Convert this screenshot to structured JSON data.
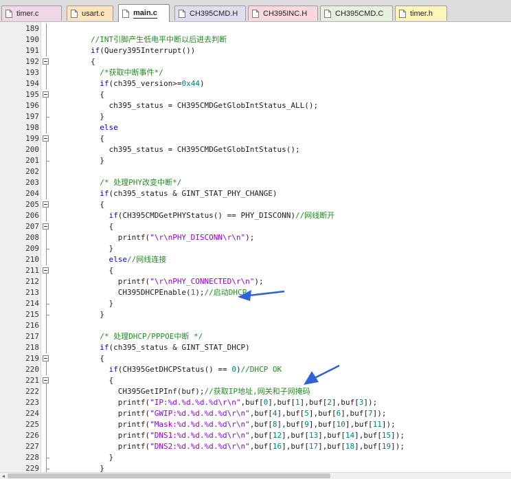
{
  "tabs": [
    {
      "label": "timer.c",
      "color": "#f0d8e6",
      "active": false
    },
    {
      "label": "usart.c",
      "color": "#fbe4bd",
      "active": false
    },
    {
      "label": "main.c",
      "color": "#ffffff",
      "active": true
    },
    {
      "label": "CH395CMD.H",
      "color": "#e2dcf0",
      "active": false
    },
    {
      "label": "CH395INC.H",
      "color": "#f8d8dc",
      "active": false
    },
    {
      "label": "CH395CMD.C",
      "color": "#e6f0dc",
      "active": false
    },
    {
      "label": "timer.h",
      "color": "#fff4bc",
      "active": false
    }
  ],
  "code": {
    "lines": [
      {
        "n": "189",
        "fold": "line",
        "tokens": []
      },
      {
        "n": "190",
        "fold": "line",
        "tokens": [
          [
            "        ",
            ""
          ],
          [
            "//INT引脚产生低电平中断以后进去判断",
            "cm"
          ]
        ]
      },
      {
        "n": "191",
        "fold": "line",
        "tokens": [
          [
            "        ",
            ""
          ],
          [
            "if",
            "kw"
          ],
          [
            "(Query395Interrupt())",
            ""
          ]
        ]
      },
      {
        "n": "192",
        "fold": "box",
        "tokens": [
          [
            "        {",
            ""
          ]
        ]
      },
      {
        "n": "193",
        "fold": "line",
        "tokens": [
          [
            "          ",
            ""
          ],
          [
            "/*获取中断事件*/",
            "cm"
          ]
        ]
      },
      {
        "n": "194",
        "fold": "line",
        "tokens": [
          [
            "          ",
            ""
          ],
          [
            "if",
            "kw"
          ],
          [
            "(ch395_version>=",
            ""
          ],
          [
            "0x44",
            "nm"
          ],
          [
            ")",
            ""
          ]
        ]
      },
      {
        "n": "195",
        "fold": "box",
        "tokens": [
          [
            "          {",
            ""
          ]
        ]
      },
      {
        "n": "196",
        "fold": "line",
        "tokens": [
          [
            "            ch395_status = CH395CMDGetGlobIntStatus_ALL();",
            ""
          ]
        ]
      },
      {
        "n": "197",
        "fold": "end",
        "tokens": [
          [
            "          }",
            ""
          ]
        ]
      },
      {
        "n": "198",
        "fold": "line",
        "tokens": [
          [
            "          ",
            ""
          ],
          [
            "else",
            "kw"
          ]
        ]
      },
      {
        "n": "199",
        "fold": "box",
        "tokens": [
          [
            "          {",
            ""
          ]
        ]
      },
      {
        "n": "200",
        "fold": "line",
        "tokens": [
          [
            "            ch395_status = CH395CMDGetGlobIntStatus();",
            ""
          ]
        ]
      },
      {
        "n": "201",
        "fold": "end",
        "tokens": [
          [
            "          }",
            ""
          ]
        ]
      },
      {
        "n": "202",
        "fold": "line",
        "tokens": []
      },
      {
        "n": "203",
        "fold": "line",
        "tokens": [
          [
            "          ",
            ""
          ],
          [
            "/* 处理PHY改变中断*/",
            "cm"
          ]
        ]
      },
      {
        "n": "204",
        "fold": "line",
        "tokens": [
          [
            "          ",
            ""
          ],
          [
            "if",
            "kw"
          ],
          [
            "(ch395_status & GINT_STAT_PHY_CHANGE)",
            ""
          ]
        ]
      },
      {
        "n": "205",
        "fold": "box",
        "tokens": [
          [
            "          {",
            ""
          ]
        ]
      },
      {
        "n": "206",
        "fold": "line",
        "tokens": [
          [
            "            ",
            ""
          ],
          [
            "if",
            "kw"
          ],
          [
            "(CH395CMDGetPHYStatus() == PHY_DISCONN)",
            ""
          ],
          [
            "//网线断开",
            "cm"
          ]
        ]
      },
      {
        "n": "207",
        "fold": "box",
        "tokens": [
          [
            "            {",
            ""
          ]
        ]
      },
      {
        "n": "208",
        "fold": "line",
        "tokens": [
          [
            "              printf(",
            ""
          ],
          [
            "\"\\r\\nPHY_DISCONN\\r\\n\"",
            "st"
          ],
          [
            ");",
            ""
          ]
        ]
      },
      {
        "n": "209",
        "fold": "end",
        "tokens": [
          [
            "            }",
            ""
          ]
        ]
      },
      {
        "n": "210",
        "fold": "line",
        "tokens": [
          [
            "            ",
            ""
          ],
          [
            "else",
            "kw"
          ],
          [
            "//网线连接",
            "cm"
          ]
        ]
      },
      {
        "n": "211",
        "fold": "box",
        "tokens": [
          [
            "            {",
            ""
          ]
        ]
      },
      {
        "n": "212",
        "fold": "line",
        "tokens": [
          [
            "              printf(",
            ""
          ],
          [
            "\"\\r\\nPHY_CONNECTED\\r\\n\"",
            "st"
          ],
          [
            ");",
            ""
          ]
        ]
      },
      {
        "n": "213",
        "fold": "line",
        "tokens": [
          [
            "              CH395DHCPEnable(",
            ""
          ],
          [
            "1",
            "nm"
          ],
          [
            ");",
            ""
          ],
          [
            "//启动DHCP",
            "cm"
          ]
        ]
      },
      {
        "n": "214",
        "fold": "end",
        "tokens": [
          [
            "            }",
            ""
          ]
        ]
      },
      {
        "n": "215",
        "fold": "end",
        "tokens": [
          [
            "          }",
            ""
          ]
        ]
      },
      {
        "n": "216",
        "fold": "line",
        "tokens": []
      },
      {
        "n": "217",
        "fold": "line",
        "tokens": [
          [
            "          ",
            ""
          ],
          [
            "/* 处理DHCP/PPPOE中断 */",
            "cm"
          ]
        ]
      },
      {
        "n": "218",
        "fold": "line",
        "tokens": [
          [
            "          ",
            ""
          ],
          [
            "if",
            "kw"
          ],
          [
            "(ch395_status & GINT_STAT_DHCP)",
            ""
          ]
        ]
      },
      {
        "n": "219",
        "fold": "box",
        "tokens": [
          [
            "          {",
            ""
          ]
        ]
      },
      {
        "n": "220",
        "fold": "line",
        "tokens": [
          [
            "            ",
            ""
          ],
          [
            "if",
            "kw"
          ],
          [
            "(CH395GetDHCPStatus() == ",
            ""
          ],
          [
            "0",
            "nm"
          ],
          [
            ")",
            ""
          ],
          [
            "//DHCP OK",
            "cm"
          ]
        ]
      },
      {
        "n": "221",
        "fold": "box",
        "tokens": [
          [
            "            {",
            ""
          ]
        ]
      },
      {
        "n": "222",
        "fold": "line",
        "tokens": [
          [
            "              CH395GetIPInf(buf);",
            ""
          ],
          [
            "//获取IP地址,网关和子网掩码",
            "cm"
          ]
        ]
      },
      {
        "n": "223",
        "fold": "line",
        "tokens": [
          [
            "              printf(",
            ""
          ],
          [
            "\"IP:%d.%d.%d.%d\\r\\n\"",
            "st"
          ],
          [
            ",buf[",
            ""
          ],
          [
            "0",
            "nm"
          ],
          [
            "],buf[",
            ""
          ],
          [
            "1",
            "nm"
          ],
          [
            "],buf[",
            ""
          ],
          [
            "2",
            "nm"
          ],
          [
            "],buf[",
            ""
          ],
          [
            "3",
            "nm"
          ],
          [
            "]);",
            ""
          ]
        ]
      },
      {
        "n": "224",
        "fold": "line",
        "tokens": [
          [
            "              printf(",
            ""
          ],
          [
            "\"GWIP:%d.%d.%d.%d\\r\\n\"",
            "st"
          ],
          [
            ",buf[",
            ""
          ],
          [
            "4",
            "nm"
          ],
          [
            "],buf[",
            ""
          ],
          [
            "5",
            "nm"
          ],
          [
            "],buf[",
            ""
          ],
          [
            "6",
            "nm"
          ],
          [
            "],buf[",
            ""
          ],
          [
            "7",
            "nm"
          ],
          [
            "]);",
            ""
          ]
        ]
      },
      {
        "n": "225",
        "fold": "line",
        "tokens": [
          [
            "              printf(",
            ""
          ],
          [
            "\"Mask:%d.%d.%d.%d\\r\\n\"",
            "st"
          ],
          [
            ",buf[",
            ""
          ],
          [
            "8",
            "nm"
          ],
          [
            "],buf[",
            ""
          ],
          [
            "9",
            "nm"
          ],
          [
            "],buf[",
            ""
          ],
          [
            "10",
            "nm"
          ],
          [
            "],buf[",
            ""
          ],
          [
            "11",
            "nm"
          ],
          [
            "]);",
            ""
          ]
        ]
      },
      {
        "n": "226",
        "fold": "line",
        "tokens": [
          [
            "              printf(",
            ""
          ],
          [
            "\"DNS1:%d.%d.%d.%d\\r\\n\"",
            "st"
          ],
          [
            ",buf[",
            ""
          ],
          [
            "12",
            "nm"
          ],
          [
            "],buf[",
            ""
          ],
          [
            "13",
            "nm"
          ],
          [
            "],buf[",
            ""
          ],
          [
            "14",
            "nm"
          ],
          [
            "],buf[",
            ""
          ],
          [
            "15",
            "nm"
          ],
          [
            "]);",
            ""
          ]
        ]
      },
      {
        "n": "227",
        "fold": "line",
        "tokens": [
          [
            "              printf(",
            ""
          ],
          [
            "\"DNS2:%d.%d.%d.%d\\r\\n\"",
            "st"
          ],
          [
            ",buf[",
            ""
          ],
          [
            "16",
            "nm"
          ],
          [
            "],buf[",
            ""
          ],
          [
            "17",
            "nm"
          ],
          [
            "],buf[",
            ""
          ],
          [
            "18",
            "nm"
          ],
          [
            "],buf[",
            ""
          ],
          [
            "19",
            "nm"
          ],
          [
            "]);",
            ""
          ]
        ]
      },
      {
        "n": "228",
        "fold": "end",
        "tokens": [
          [
            "            }",
            ""
          ]
        ]
      },
      {
        "n": "229",
        "fold": "end",
        "tokens": [
          [
            "          }",
            ""
          ]
        ]
      }
    ]
  },
  "colors": {
    "comment": "#228b22",
    "keyword": "#0000ee",
    "string": "#9400d3",
    "number": "#008080",
    "annotation_arrow": "#2f62d8"
  }
}
